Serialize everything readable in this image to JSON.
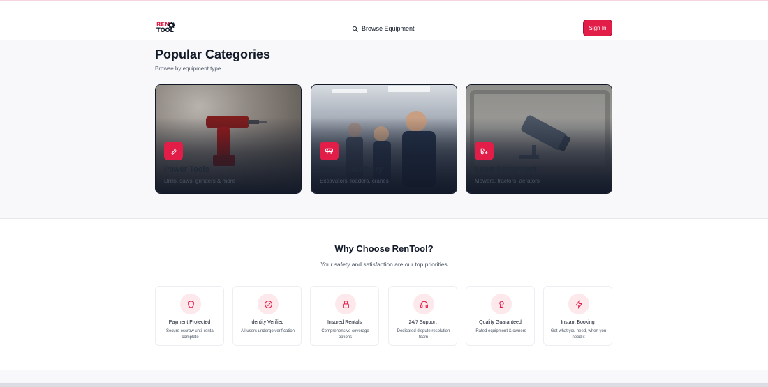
{
  "header": {
    "logo_top": "REN",
    "logo_bottom": "TOOL",
    "browse_label": "Browse Equipment",
    "signin_label": "Sign In"
  },
  "categories": {
    "title": "Popular Categories",
    "subtitle": "Browse by equipment type",
    "items": [
      {
        "title": "Power Tools",
        "desc": "Drills, saws, grinders & more",
        "icon": "wrench-icon"
      },
      {
        "title": "Heavy Machinery",
        "desc": "Excavators, loaders, cranes",
        "icon": "construction-icon"
      },
      {
        "title": "Lawn Equipment",
        "desc": "Mowers, tractors, aerators",
        "icon": "tractor-icon"
      }
    ]
  },
  "why": {
    "title": "Why Choose RenTool?",
    "subtitle": "Your safety and satisfaction are our top priorities",
    "features": [
      {
        "title": "Payment Protected",
        "desc": "Secure escrow until rental complete",
        "icon": "shield-icon"
      },
      {
        "title": "Identity Verified",
        "desc": "All users undergo verification",
        "icon": "check-circle-icon"
      },
      {
        "title": "Insured Rentals",
        "desc": "Comprehensive coverage options",
        "icon": "lock-icon"
      },
      {
        "title": "24/7 Support",
        "desc": "Dedicated dispute resolution team",
        "icon": "headphones-icon"
      },
      {
        "title": "Quality Guaranteed",
        "desc": "Rated equipment & owners",
        "icon": "award-icon"
      },
      {
        "title": "Instant Booking",
        "desc": "Get what you need, when you need it",
        "icon": "zap-icon"
      }
    ]
  },
  "colors": {
    "accent": "#e11d48",
    "accent_soft": "#fde8ec",
    "text": "#111827",
    "muted": "#4b5563"
  }
}
